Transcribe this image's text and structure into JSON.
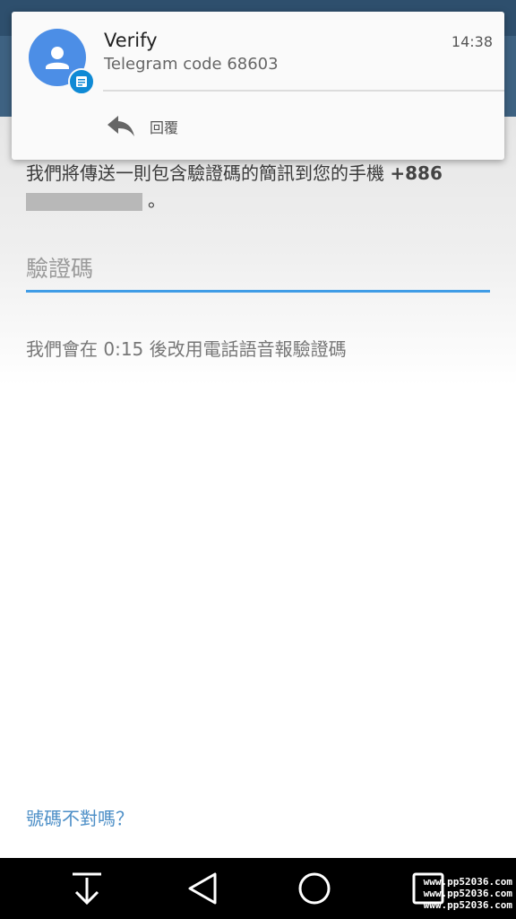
{
  "notification": {
    "title": "Verify",
    "time": "14:38",
    "body": "Telegram code 68603",
    "reply_label": "回覆",
    "avatar_icon": "person-icon",
    "badge_icon": "message-icon",
    "avatar_color": "#4c8ee6",
    "badge_color": "#0f8ad5"
  },
  "main": {
    "sms_text": "我們將傳送一則包含驗證碼的簡訊到您的手機",
    "phone_prefix": "+886",
    "sms_text_end": "。",
    "code_placeholder": "驗證碼",
    "call_text": "我們會在 0:15 後改用電話語音報驗證碼",
    "wrong_number": "號碼不對嗎？",
    "accent_color": "#3f9ce6"
  },
  "navbar": {
    "buttons": [
      "download-icon",
      "back-icon",
      "home-icon",
      "recents-icon"
    ]
  },
  "watermark": {
    "lines": [
      "www.pp52036.com",
      "www.pp52036.com",
      "www.pp52036.com"
    ]
  }
}
